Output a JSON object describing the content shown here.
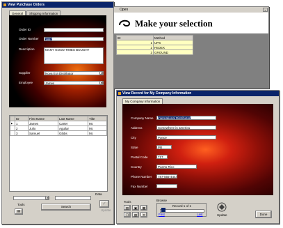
{
  "purchase_orders": {
    "title": "View Purchase Orders",
    "tabs": [
      "General",
      "Shipping Information"
    ],
    "order_id_label": "Order ID",
    "order_number_label": "Order Number",
    "order_number_value": "1867",
    "description_label": "Description",
    "description_value": "MANY GOOD TIMES BOUGHT",
    "supplier_label": "Supplier",
    "supplier_value": "Nova Era Distributor",
    "employee_label": "Employee",
    "employee_value": "James",
    "grid_headers": [
      "",
      "ID",
      "First Name",
      "Last Name",
      "Title"
    ],
    "grid_rows": [
      [
        "▶",
        "1",
        "James",
        "Carter",
        "Mr."
      ],
      [
        "",
        "2",
        "Julio",
        "Aguilar",
        "Mr."
      ],
      [
        "",
        "3",
        "Samuel",
        "Gibbs",
        "Mr."
      ]
    ],
    "tools_label": "Tools",
    "search_label": "Search",
    "data_label": "Data",
    "update_label": "Update"
  },
  "open_dialog": {
    "title": "Open",
    "heading": "Make your selection",
    "columns": [
      "ID",
      "Method"
    ],
    "rows": [
      {
        "id": "1",
        "method": "UPS"
      },
      {
        "id": "2",
        "method": "FEDEX"
      },
      {
        "id": "3",
        "method": "GROUND"
      }
    ]
  },
  "company_info": {
    "title": "View Record for My Company Information",
    "tab": "My Company Information",
    "fields": [
      {
        "label": "Company Name",
        "value": "International Distributor"
      },
      {
        "label": "Address",
        "value": "Somewhere in america"
      },
      {
        "label": "City",
        "value": "Ponce"
      },
      {
        "label": "State",
        "value": "PR"
      },
      {
        "label": "Postal Code",
        "value": "717"
      },
      {
        "label": "Country",
        "value": "Puerto Rico"
      },
      {
        "label": "Phone Number",
        "value": "787-555-4444"
      },
      {
        "label": "Fax Number",
        "value": ""
      }
    ],
    "tools_label": "Tools",
    "browse_label": "Browse",
    "record_text": "Record 1 of 1",
    "first_label": "First",
    "last_label": "Last",
    "update_label": "Update",
    "done_label": "Done"
  }
}
